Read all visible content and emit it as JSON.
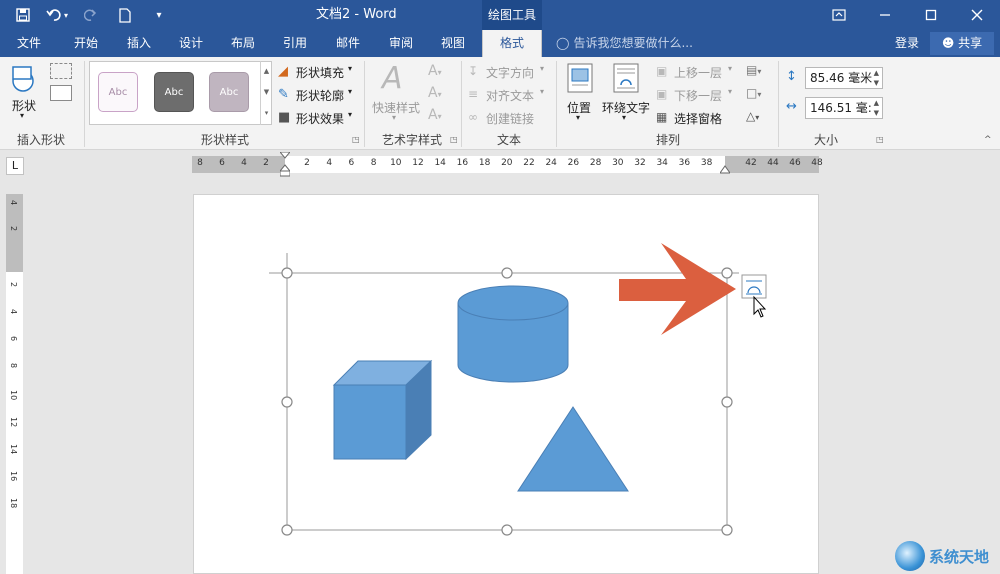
{
  "window": {
    "title": "文档2 - Word",
    "contextual_tab": "绘图工具"
  },
  "qat": {
    "save_icon": "save-icon",
    "undo_icon": "undo-icon",
    "redo_icon": "redo-icon",
    "new_icon": "new-doc-icon",
    "customize_icon": "customize-icon"
  },
  "tabs": [
    {
      "label": "文件"
    },
    {
      "label": "开始"
    },
    {
      "label": "插入"
    },
    {
      "label": "设计"
    },
    {
      "label": "布局"
    },
    {
      "label": "引用"
    },
    {
      "label": "邮件"
    },
    {
      "label": "审阅"
    },
    {
      "label": "视图"
    },
    {
      "label": "格式",
      "active": true
    }
  ],
  "tell_me": "告诉我您想要做什么...",
  "account": {
    "login": "登录",
    "share": "共享"
  },
  "ribbon": {
    "insert_shapes": {
      "shapes_label": "形状",
      "group": "插入形状"
    },
    "shape_styles": {
      "swatches": [
        "Abc",
        "Abc",
        "Abc"
      ],
      "fill": "形状填充",
      "outline": "形状轮廓",
      "effects": "形状效果",
      "group": "形状样式"
    },
    "wordart": {
      "quick_styles": "快速样式",
      "group": "艺术字样式"
    },
    "text": {
      "direction": "文字方向",
      "align": "对齐文本",
      "link": "创建链接",
      "group": "文本"
    },
    "arrange": {
      "position": "位置",
      "wrap": "环绕文字",
      "forward": "上移一层",
      "backward": "下移一层",
      "pane": "选择窗格",
      "group": "排列"
    },
    "size": {
      "height": "85.46 毫米",
      "width": "146.51 毫:",
      "group": "大小"
    }
  },
  "ruler": {
    "h_numbers": [
      "8",
      "6",
      "4",
      "2",
      "2",
      "4",
      "6",
      "8",
      "10",
      "12",
      "14",
      "16",
      "18",
      "20",
      "22",
      "24",
      "26",
      "28",
      "30",
      "32",
      "34",
      "36",
      "38",
      "42",
      "44",
      "46",
      "48"
    ],
    "v_numbers": [
      "4",
      "2",
      "2",
      "4",
      "6",
      "8",
      "10",
      "12",
      "14",
      "16",
      "18"
    ]
  },
  "canvas": {
    "colors": {
      "shape_fill": "#5b9bd5",
      "shape_dark": "#4a7fb5",
      "shape_light": "#7fb0e0",
      "arrow": "#db5f3f",
      "handle": "#888888"
    },
    "shapes": [
      "cube",
      "cylinder",
      "triangle",
      "right-arrow"
    ]
  },
  "watermark": {
    "text": "系统天地"
  }
}
